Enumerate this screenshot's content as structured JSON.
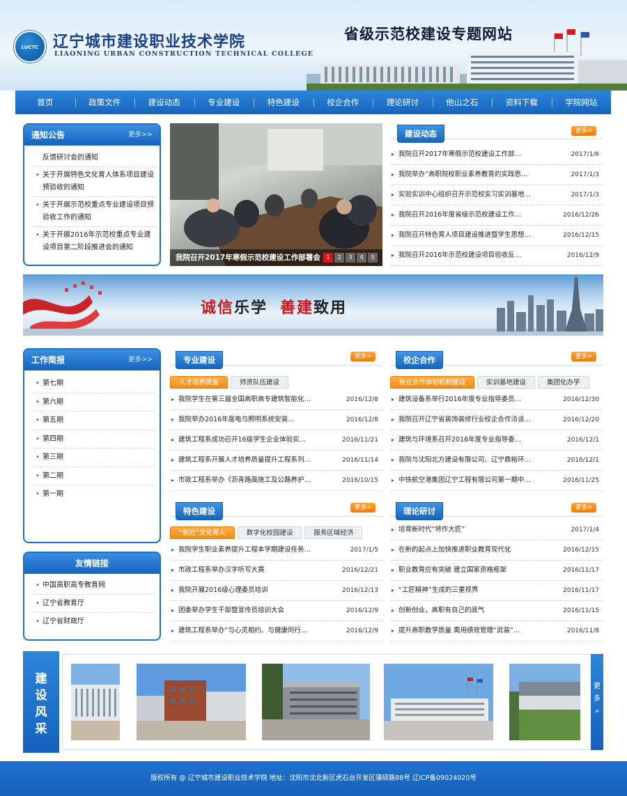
{
  "header": {
    "logo_text": "LUCTC",
    "college_cn": "辽宁城市建设职业技术学院",
    "college_en": "LIAONING URBAN CONSTRUCTION TECHNICAL COLLEGE",
    "site_title": "省级示范校建设专题网站"
  },
  "nav": [
    "首页",
    "政策文件",
    "建设动态",
    "专业建设",
    "特色建设",
    "校企合作",
    "理论研讨",
    "他山之石",
    "资料下载",
    "学院网站"
  ],
  "notice": {
    "title": "通知公告",
    "more": "更多>>",
    "items": [
      "反馈研讨会的通知",
      "关于开展特色文化育人体系项目建设预验收的通知",
      "关于开展示范校重点专业建设项目预验收工作的通知",
      "关于开展2016年示范校重点专业建设项目第二阶段推进会的通知"
    ]
  },
  "slideshow": {
    "caption": "我院召开2017年寒假示范校建设工作部署会",
    "pages": [
      "1",
      "2",
      "3",
      "4",
      "5"
    ]
  },
  "build_news": {
    "title": "建设动态",
    "more": "更多>",
    "items": [
      {
        "t": "我院召开2017年寒假示范校建设工作部…",
        "d": "2017/1/6"
      },
      {
        "t": "我院举办“高职院校职业素养教育的实践思…",
        "d": "2017/1/3"
      },
      {
        "t": "实验实训中心组织召开示范校实习实训基地…",
        "d": "2017/1/3"
      },
      {
        "t": "我院召开2016年度省级示范校建设工作…",
        "d": "2016/12/26"
      },
      {
        "t": "我院召开特色育人项目建设推进暨学生思想…",
        "d": "2016/12/15"
      },
      {
        "t": "我院召开2016年示范校建设项目验收反…",
        "d": "2016/12/9"
      }
    ]
  },
  "banner": {
    "s1": "诚信",
    "s2": "乐学",
    "s3": "善建",
    "s4": "致用"
  },
  "work": {
    "title": "工作简报",
    "more": "更多>>",
    "items": [
      "第七期",
      "第六期",
      "第五期",
      "第四期",
      "第三期",
      "第二期",
      "第一期"
    ]
  },
  "links": {
    "title": "友情链接",
    "items": [
      "中国高职高专教育网",
      "辽宁省教育厅",
      "辽宁省财政厅"
    ]
  },
  "major": {
    "title": "专业建设",
    "more": "更多>",
    "tabs": [
      "人才培养质量",
      "师资队伍建设"
    ],
    "items": [
      {
        "t": "我院学生在第三届全国高职高专建筑智能化…",
        "d": "2016/12/8"
      },
      {
        "t": "我院举办2016年度电与照明系统安装…",
        "d": "2016/12/8"
      },
      {
        "t": "建筑工程系成功召开16级学生企业体验实…",
        "d": "2016/11/21"
      },
      {
        "t": "建筑工程系开展人才培养质量提升工程系列…",
        "d": "2016/11/14"
      },
      {
        "t": "市政工程系举办《沥青路面施工及公路养护…",
        "d": "2016/10/15"
      }
    ]
  },
  "coop": {
    "title": "校企合作",
    "more": "更多>",
    "tabs": [
      "校企合作体制机制建设",
      "实训基地建设",
      "集团化办学"
    ],
    "items": [
      {
        "t": "建筑设备系举行2016年度专业指导委员…",
        "d": "2016/12/30"
      },
      {
        "t": "我院召开辽宁省装饰装修行业校企合作洽谈…",
        "d": "2016/12/20"
      },
      {
        "t": "建筑与环境系召开2016年度专业指导委…",
        "d": "2016/12/1"
      },
      {
        "t": "我院与沈阳北方建设有限公司、辽宁鼎裕环…",
        "d": "2016/12/1"
      },
      {
        "t": "中铁航空港集团辽宁工程有限公司第一期中…",
        "d": "2016/11/25"
      }
    ]
  },
  "feature": {
    "title": "特色建设",
    "more": "更多>",
    "tabs": [
      "“筑砼”文化育人",
      "数字化校园建设",
      "服务区域经济"
    ],
    "items": [
      {
        "t": "我院学生职业素养提升工程本学期建设任务…",
        "d": "2017/1/5"
      },
      {
        "t": "市政工程系举办汉字听写大赛",
        "d": "2016/12/21"
      },
      {
        "t": "我院开展2016级心理委员培训",
        "d": "2016/12/13"
      },
      {
        "t": "团委举办学生干部暨宣传员培训大会",
        "d": "2016/12/9"
      },
      {
        "t": "建筑工程系举办“与心灵相约、与健康同行…",
        "d": "2016/12/9"
      }
    ]
  },
  "theory": {
    "title": "理论研讨",
    "more": "更多>",
    "items": [
      {
        "t": "培育新时代“将作大匠”",
        "d": "2017/1/4"
      },
      {
        "t": "在新的起点上加快推进职业教育现代化",
        "d": "2016/12/15"
      },
      {
        "t": "职业教育应有突破 建立国家资格框架",
        "d": "2016/11/17"
      },
      {
        "t": "“工匠精神”生成的三重视界",
        "d": "2016/11/17"
      },
      {
        "t": "创新创业，高职有自己的底气",
        "d": "2016/11/15"
      },
      {
        "t": "提升高职教学质量 需用绩效管理“武装”…",
        "d": "2016/11/8"
      }
    ]
  },
  "gallery": {
    "title_chars": [
      "建",
      "设",
      "风",
      "采"
    ],
    "more_chars": [
      "更",
      "多",
      "»"
    ]
  },
  "footer": "版权所有 @ 辽宁城市建设职业技术学院  地址：沈阳市沈北新区虎石台开发区蒲硕路88号  辽ICP备09024020号",
  "colors": {
    "brand_blue": "#1663bf",
    "accent_orange": "#f38b12",
    "accent_red": "#d8161d"
  }
}
